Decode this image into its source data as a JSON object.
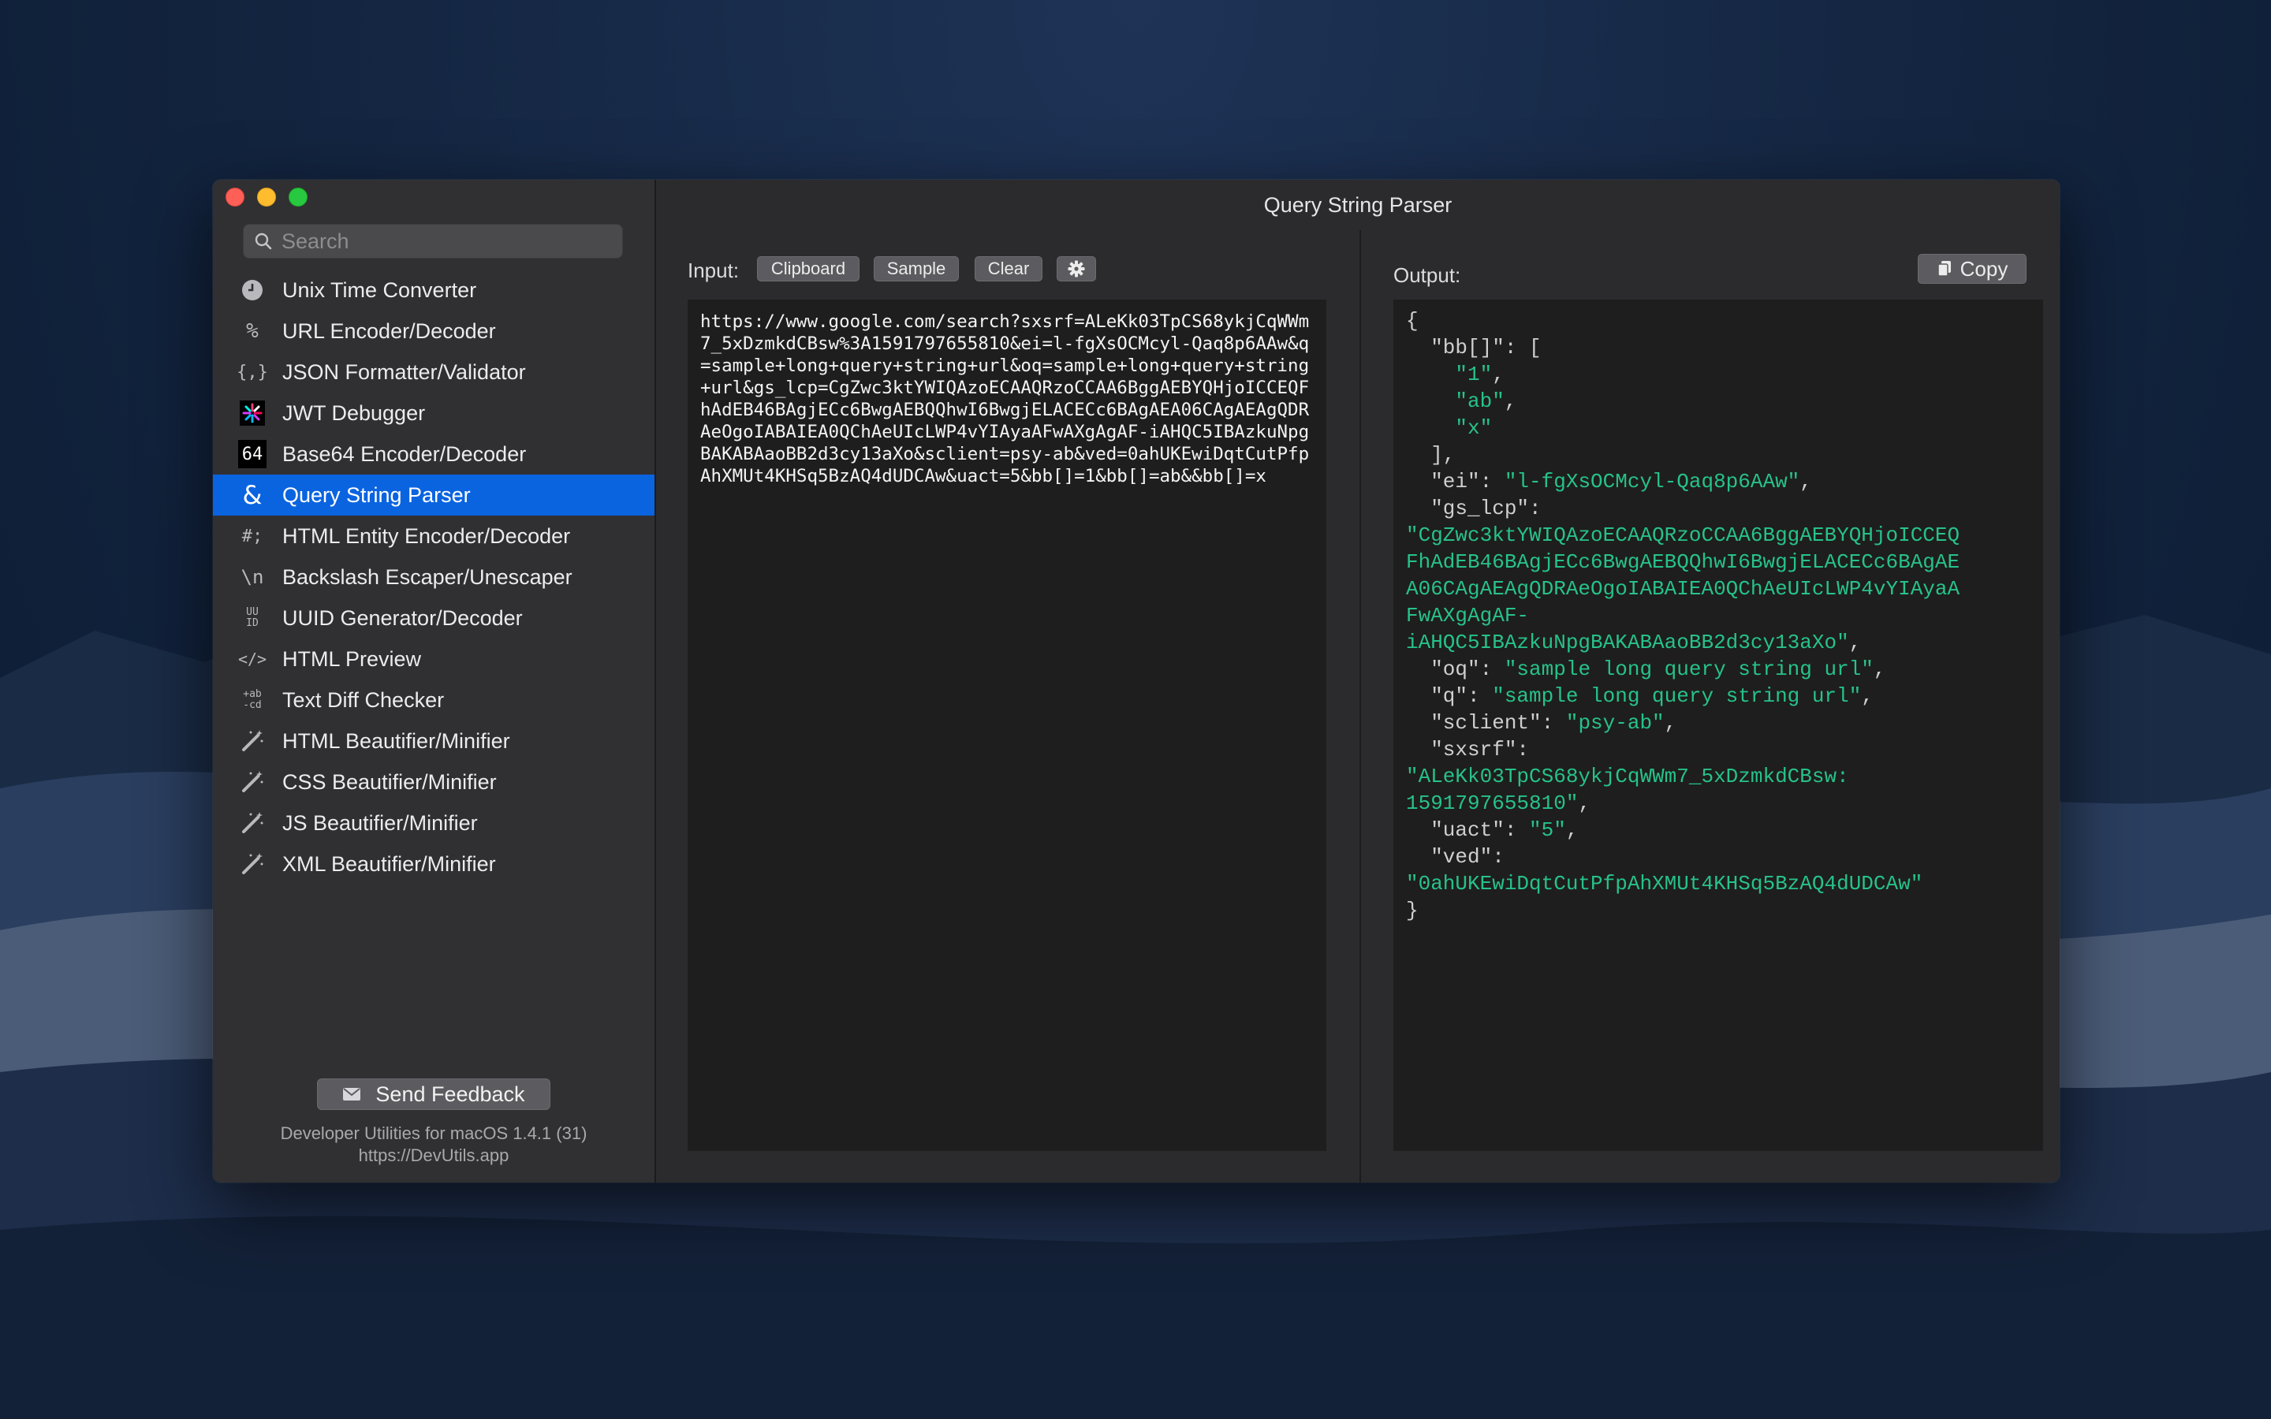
{
  "sidebar": {
    "search_placeholder": "Search",
    "items": [
      {
        "label": "Unix Time Converter",
        "icon": "clock-icon"
      },
      {
        "label": "URL Encoder/Decoder",
        "icon": "percent-icon"
      },
      {
        "label": "JSON Formatter/Validator",
        "icon": "braces-icon"
      },
      {
        "label": "JWT Debugger",
        "icon": "jwt-icon"
      },
      {
        "label": "Base64 Encoder/Decoder",
        "icon": "base64-icon"
      },
      {
        "label": "Query String Parser",
        "icon": "ampersand-icon",
        "active": true
      },
      {
        "label": "HTML Entity Encoder/Decoder",
        "icon": "hash-semicolon-icon"
      },
      {
        "label": "Backslash Escaper/Unescaper",
        "icon": "backslash-n-icon"
      },
      {
        "label": "UUID Generator/Decoder",
        "icon": "uuid-icon"
      },
      {
        "label": "HTML Preview",
        "icon": "code-tag-icon"
      },
      {
        "label": "Text Diff Checker",
        "icon": "diff-icon"
      },
      {
        "label": "HTML Beautifier/Minifier",
        "icon": "magic-wand-icon"
      },
      {
        "label": "CSS Beautifier/Minifier",
        "icon": "magic-wand-icon"
      },
      {
        "label": "JS Beautifier/Minifier",
        "icon": "magic-wand-icon"
      },
      {
        "label": "XML Beautifier/Minifier",
        "icon": "magic-wand-icon"
      }
    ],
    "feedback_label": "Send Feedback",
    "footer_line1": "Developer Utilities for macOS 1.4.1 (31)",
    "footer_line2": "https://DevUtils.app"
  },
  "main": {
    "title": "Query String Parser",
    "input_label": "Input:",
    "buttons": {
      "clipboard": "Clipboard",
      "sample": "Sample",
      "clear": "Clear"
    },
    "output_label": "Output:",
    "copy_label": "Copy",
    "input_text": "https://www.google.com/search?sxsrf=ALeKk03TpCS68ykjCqWWm7_5xDzmkdCBsw%3A1591797655810&ei=l-fgXsOCMcyl-Qaq8p6AAw&q=sample+long+query+string+url&oq=sample+long+query+string+url&gs_lcp=CgZwc3ktYWIQAzoECAAQRzoCCAA6BggAEBYQHjoICCEQFhAdEB46BAgjECc6BwgAEBQQhwI6BwgjELACECc6BAgAEA06CAgAEAgQDRAeOgoIABAIEA0QChAeUIcLWP4vYIAyaAFwAXgAgAF-iAHQC5IBAzkuNpgBAKABAaoBB2d3cy13aXo&sclient=psy-ab&ved=0ahUKEwiDqtCutPfpAhXMUt4KHSq5BzAQ4dUDCAw&uact=5&bb[]=1&bb[]=ab&&bb[]=x",
    "output_lines": [
      [
        [
          "k",
          "{"
        ]
      ],
      [
        [
          "k",
          "  \"bb[]\": ["
        ]
      ],
      [
        [
          "s",
          "    \"1\""
        ],
        [
          "k",
          ","
        ]
      ],
      [
        [
          "s",
          "    \"ab\""
        ],
        [
          "k",
          ","
        ]
      ],
      [
        [
          "s",
          "    \"x\""
        ]
      ],
      [
        [
          "k",
          "  ],"
        ]
      ],
      [
        [
          "k",
          "  \"ei\": "
        ],
        [
          "s",
          "\"l-fgXsOCMcyl-Qaq8p6AAw\""
        ],
        [
          "k",
          ","
        ]
      ],
      [
        [
          "k",
          "  \"gs_lcp\":"
        ]
      ],
      [
        [
          "s",
          "\"CgZwc3ktYWIQAzoECAAQRzoCCAA6BggAEBYQHjoICCEQ"
        ]
      ],
      [
        [
          "s",
          "FhAdEB46BAgjECc6BwgAEBQQhwI6BwgjELACECc6BAgAE"
        ]
      ],
      [
        [
          "s",
          "A06CAgAEAgQDRAeOgoIABAIEA0QChAeUIcLWP4vYIAyaA"
        ]
      ],
      [
        [
          "s",
          "FwAXgAgAF-"
        ]
      ],
      [
        [
          "s",
          "iAHQC5IBAzkuNpgBAKABAaoBB2d3cy13aXo\""
        ],
        [
          "k",
          ","
        ]
      ],
      [
        [
          "k",
          "  \"oq\": "
        ],
        [
          "s",
          "\"sample long query string url\""
        ],
        [
          "k",
          ","
        ]
      ],
      [
        [
          "k",
          "  \"q\": "
        ],
        [
          "s",
          "\"sample long query string url\""
        ],
        [
          "k",
          ","
        ]
      ],
      [
        [
          "k",
          "  \"sclient\": "
        ],
        [
          "s",
          "\"psy-ab\""
        ],
        [
          "k",
          ","
        ]
      ],
      [
        [
          "k",
          "  \"sxsrf\":"
        ]
      ],
      [
        [
          "s",
          "\"ALeKk03TpCS68ykjCqWWm7_5xDzmkdCBsw:"
        ]
      ],
      [
        [
          "s",
          "1591797655810\""
        ],
        [
          "k",
          ","
        ]
      ],
      [
        [
          "k",
          "  \"uact\": "
        ],
        [
          "s",
          "\"5\""
        ],
        [
          "k",
          ","
        ]
      ],
      [
        [
          "k",
          "  \"ved\":"
        ]
      ],
      [
        [
          "s",
          "\"0ahUKEwiDqtCutPfpAhXMUt4KHSq5BzAQ4dUDCAw\""
        ]
      ],
      [
        [
          "k",
          "}"
        ]
      ]
    ]
  },
  "colors": {
    "accent": "#0a64e0",
    "string": "#27c28a",
    "window_bg": "#2b2b2d"
  }
}
